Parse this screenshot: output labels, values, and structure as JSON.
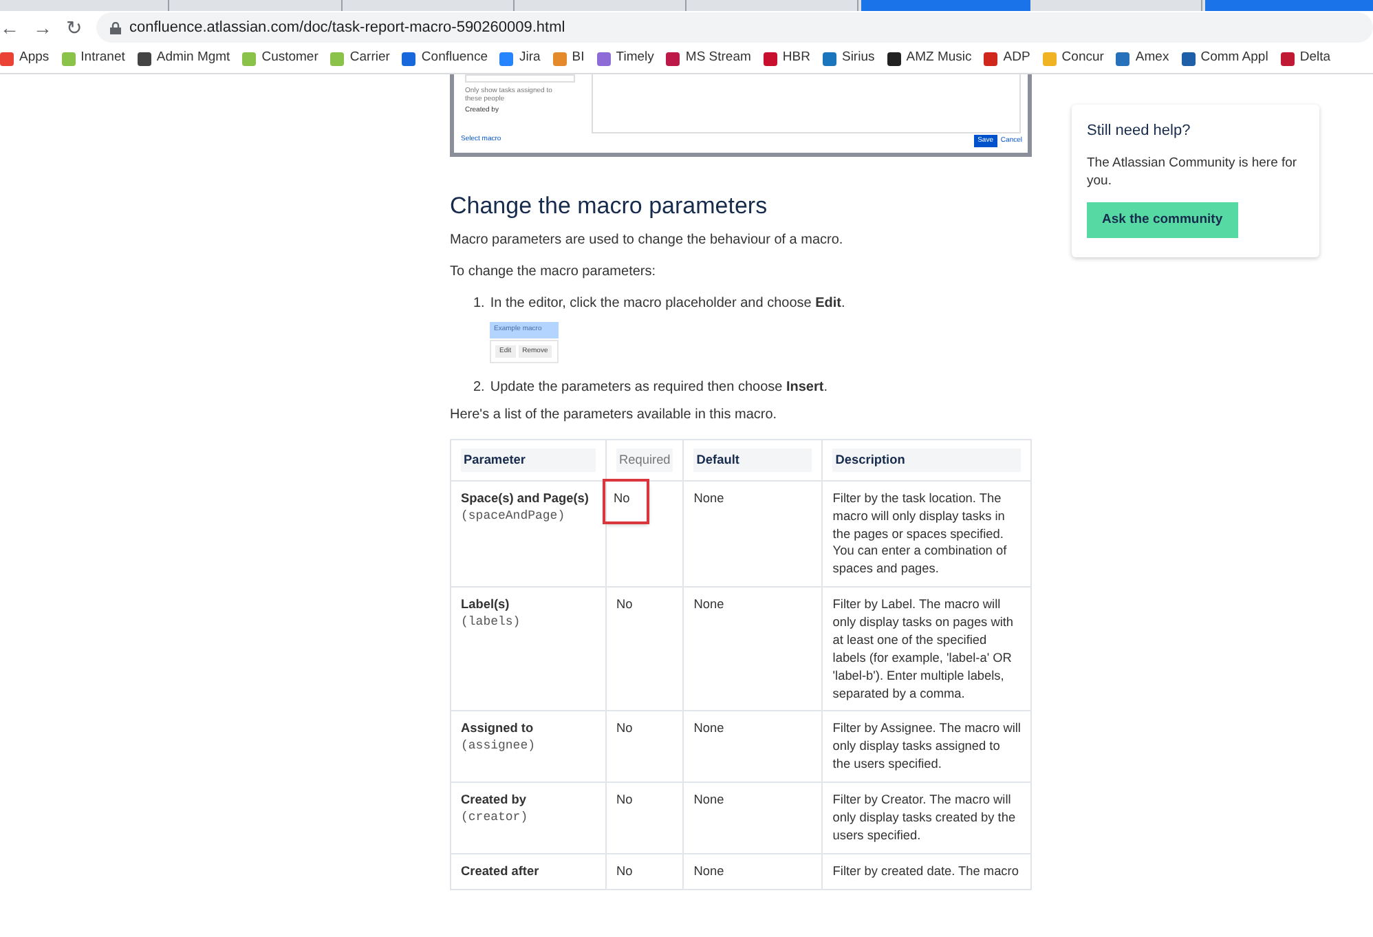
{
  "browser": {
    "nav_buttons": [
      "←",
      "→",
      "↻"
    ],
    "url": "confluence.atlassian.com/doc/task-report-macro-590260009.html",
    "bookmarks": [
      {
        "label": "Apps",
        "color": "#ea4335"
      },
      {
        "label": "Intranet",
        "color": "#8bc34a"
      },
      {
        "label": "Admin Mgmt",
        "color": "#444444"
      },
      {
        "label": "Customer",
        "color": "#8bc34a"
      },
      {
        "label": "Carrier",
        "color": "#8bc34a"
      },
      {
        "label": "Confluence",
        "color": "#1868db"
      },
      {
        "label": "Jira",
        "color": "#2684ff"
      },
      {
        "label": "BI",
        "color": "#e58a2b"
      },
      {
        "label": "Timely",
        "color": "#8e6cd8"
      },
      {
        "label": "MS Stream",
        "color": "#bc1948"
      },
      {
        "label": "HBR",
        "color": "#c8102e"
      },
      {
        "label": "Sirius",
        "color": "#1b75bc"
      },
      {
        "label": "AMZ Music",
        "color": "#222222"
      },
      {
        "label": "ADP",
        "color": "#d0271d"
      },
      {
        "label": "Concur",
        "color": "#f0b323"
      },
      {
        "label": "Amex",
        "color": "#2671b9"
      },
      {
        "label": "Comm Appl",
        "color": "#1f5fa8"
      },
      {
        "label": "Delta",
        "color": "#c01933"
      }
    ]
  },
  "dialog_screenshot": {
    "hint": "Only show tasks assigned to these people",
    "field_label": "Created by",
    "link": "Select macro",
    "buttons": [
      "Save",
      "Cancel"
    ]
  },
  "heading": "Change the macro parameters",
  "intro": "Macro parameters are used to change the behaviour of a macro.",
  "steps_intro": "To change the macro parameters:",
  "steps": [
    {
      "number": "1.",
      "text": "In the editor, click the macro placeholder and choose **Edit**."
    },
    {
      "number": "2.",
      "text": "Update the parameters as required then choose **Insert**."
    }
  ],
  "placeholder_image": {
    "macro": "Example macro",
    "buttons": [
      "Edit",
      "Remove"
    ]
  },
  "list_intro": "Here's a list of the parameters available in this macro.",
  "table": {
    "columns": [
      {
        "label": "Parameter",
        "bold": true
      },
      {
        "label": "Required",
        "bold": false
      },
      {
        "label": "Default",
        "bold": true
      },
      {
        "label": "Description",
        "bold": true
      }
    ],
    "rows": [
      {
        "name": "Space(s) and Page(s)",
        "code": "(spaceAndPage)",
        "required": "No",
        "highlighted": true,
        "default": "None",
        "description": "Filter by the task location. The macro will only display tasks in the pages or spaces specified. You can enter a combination of spaces and pages."
      },
      {
        "name": "Label(s)",
        "code": "(labels)",
        "required": "No",
        "highlighted": false,
        "default": "None",
        "description": "Filter by Label. The macro will only display tasks on pages with at least one of the specified labels (for example, 'label-a' OR 'label-b'). Enter multiple labels, separated by a comma."
      },
      {
        "name": "Assigned to",
        "code": "(assignee)",
        "required": "No",
        "highlighted": false,
        "default": "None",
        "description": "Filter by Assignee. The macro will only display tasks assigned to the users specified."
      },
      {
        "name": "Created by",
        "code": "(creator)",
        "required": "No",
        "highlighted": false,
        "default": "None",
        "description": "Filter by Creator. The macro will only display tasks created by the users specified."
      },
      {
        "name": "Created after",
        "required": "No",
        "highlighted": false,
        "default": "None",
        "description": "Filter by created date. The macro"
      }
    ]
  },
  "help_card": {
    "title": "Still need help?",
    "text": "The Atlassian Community is here for you.",
    "button": "Ask the community"
  }
}
